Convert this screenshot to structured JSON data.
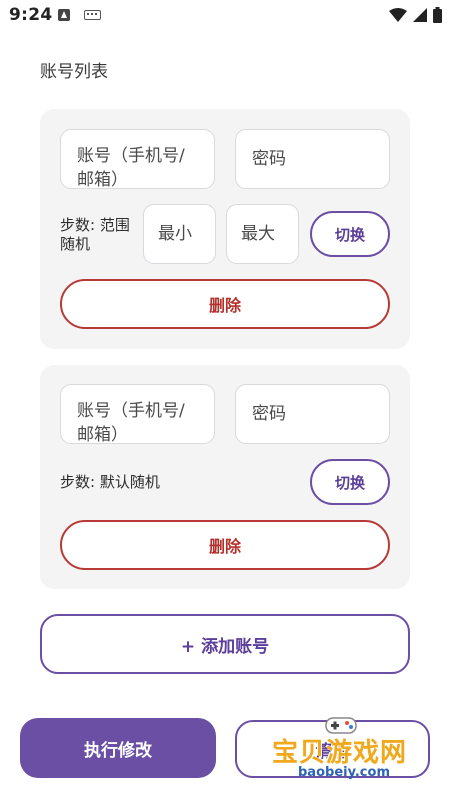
{
  "status_bar": {
    "time": "9:24",
    "icons": [
      "a-notification-icon",
      "keyboard-icon",
      "wifi-icon",
      "signal-icon",
      "battery-icon"
    ]
  },
  "page": {
    "section_title": "账号列表"
  },
  "accounts": [
    {
      "account_placeholder": "账号（手机号/邮箱）",
      "password_placeholder": "密码",
      "steps_label": "步数: 范围随机",
      "min_placeholder": "最小",
      "max_placeholder": "最大",
      "switch_label": "切换",
      "delete_label": "删除"
    },
    {
      "account_placeholder": "账号（手机号/邮箱）",
      "password_placeholder": "密码",
      "steps_label": "步数: 默认随机",
      "switch_label": "切换",
      "delete_label": "删除"
    }
  ],
  "actions": {
    "add_account": "+ 添加账号",
    "execute": "执行修改",
    "clear": "清空"
  },
  "watermark": {
    "text": "宝贝游戏网",
    "url": "baobeiy.com"
  },
  "colors": {
    "accent": "#6a4fa5",
    "danger": "#b83a36",
    "card_bg": "#f4f4f5"
  }
}
